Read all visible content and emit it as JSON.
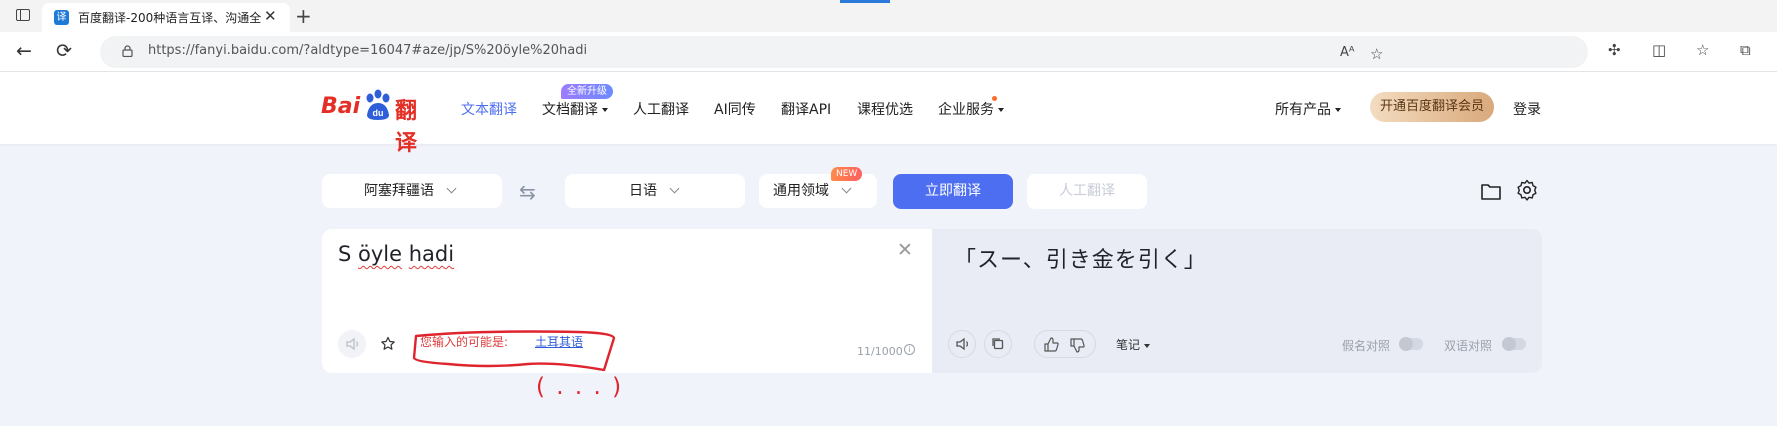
{
  "browser": {
    "tab_title": "百度翻译-200种语言互译、沟通全",
    "tab_favicon": "译",
    "url": "https://fanyi.baidu.com/?aldtype=16047#aze/jp/S%20öyle%20hadi",
    "read_aloud_label": "Aᴬ"
  },
  "site": {
    "logo_text_left": "Bai",
    "logo_text_paw": "du",
    "logo_text_right": "翻译",
    "nav": [
      {
        "label": "文本翻译"
      },
      {
        "label": "文档翻译"
      },
      {
        "label": "人工翻译"
      },
      {
        "label": "AI同传"
      },
      {
        "label": "翻译API"
      },
      {
        "label": "课程优选"
      },
      {
        "label": "企业服务"
      }
    ],
    "doc_badge": "全新升级",
    "all_products": "所有产品",
    "vip_button": "开通百度翻译会员",
    "login": "登录"
  },
  "controls": {
    "source_lang": "阿塞拜疆语",
    "target_lang": "日语",
    "domain": "通用领域",
    "domain_tag": "NEW",
    "translate_button": "立即翻译",
    "human_button": "人工翻译"
  },
  "source": {
    "word1": "S",
    "word2": "öyle",
    "word3": "hadi",
    "suggest_label": "您输入的可能是:",
    "suggest_value": "土耳其语",
    "char_count": "11/1000",
    "info_glyph": "i"
  },
  "annotation": {
    "text": "( . . . )",
    "color": "#e0242d"
  },
  "target": {
    "text": "「スー、引き金を引く」",
    "notes": "笔记",
    "toggle1": "假名对照",
    "toggle2": "双语对照"
  },
  "colors": {
    "accent": "#4e6ef2",
    "brand_red": "#e32f25",
    "annotation_red": "#e0242d"
  }
}
